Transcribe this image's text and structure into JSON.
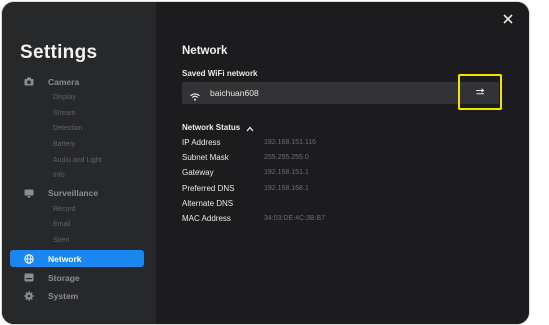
{
  "sidebar": {
    "title": "Settings",
    "groups": [
      {
        "label": "Camera",
        "icon": "camera-icon",
        "items": [
          "Display",
          "Stream",
          "Detection",
          "Battery",
          "Audio and Light",
          "Info"
        ]
      },
      {
        "label": "Surveillance",
        "icon": "monitor-icon",
        "items": [
          "Record",
          "Email",
          "Siren"
        ]
      },
      {
        "label": "Network",
        "icon": "globe-icon",
        "items": [],
        "active": true
      },
      {
        "label": "Storage",
        "icon": "storage-icon",
        "items": []
      },
      {
        "label": "System",
        "icon": "gear-icon",
        "items": []
      }
    ]
  },
  "main": {
    "title": "Network",
    "saved_wifi_label": "Saved WiFi network",
    "wifi_name": "baichuan608",
    "status_label": "Network Status",
    "status": [
      {
        "key": "IP Address",
        "value": "192.168.151.116"
      },
      {
        "key": "Subnet Mask",
        "value": "255.255.255.0"
      },
      {
        "key": "Gateway",
        "value": "192.168.151.1"
      },
      {
        "key": "Preferred DNS",
        "value": "192.168.168.1"
      },
      {
        "key": "Alternate DNS",
        "value": ""
      },
      {
        "key": "MAC Address",
        "value": "34:03:DE:4C:3B:B7"
      }
    ]
  },
  "colors": {
    "accent": "#1a86f0",
    "highlight": "#f2e600",
    "sidebar_bg": "#27282a",
    "main_bg": "#1c1c1e"
  }
}
